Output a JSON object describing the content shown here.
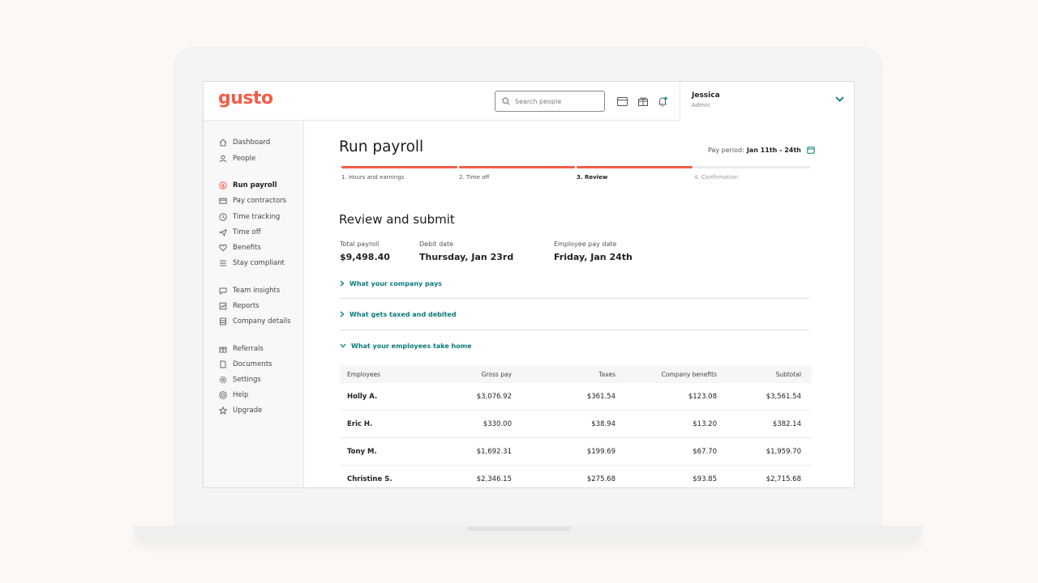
{
  "app": {
    "logo": "gusto",
    "brand_color": "#f45d48",
    "link_color": "#0a7a7a"
  },
  "header": {
    "search_placeholder": "Search people",
    "icons": [
      "card-icon",
      "gift-icon",
      "bell-icon"
    ],
    "user": {
      "name": "Jessica",
      "role": "Admin"
    }
  },
  "sidebar": {
    "items": [
      {
        "label": "Dashboard",
        "icon": "home-icon"
      },
      {
        "label": "People",
        "icon": "people-icon"
      },
      {
        "label": "Run payroll",
        "icon": "dollar-icon",
        "active": true
      },
      {
        "label": "Pay contractors",
        "icon": "contractor-icon"
      },
      {
        "label": "Time tracking",
        "icon": "clock-icon"
      },
      {
        "label": "Time off",
        "icon": "plane-icon"
      },
      {
        "label": "Benefits",
        "icon": "heart-icon"
      },
      {
        "label": "Stay compliant",
        "icon": "list-icon"
      },
      {
        "label": "Team insights",
        "icon": "chat-icon"
      },
      {
        "label": "Reports",
        "icon": "report-icon"
      },
      {
        "label": "Company details",
        "icon": "building-icon"
      },
      {
        "label": "Referrals",
        "icon": "gift-icon"
      },
      {
        "label": "Documents",
        "icon": "document-icon"
      },
      {
        "label": "Settings",
        "icon": "gear-icon"
      },
      {
        "label": "Help",
        "icon": "help-icon"
      },
      {
        "label": "Upgrade",
        "icon": "star-icon"
      }
    ]
  },
  "main": {
    "title": "Run payroll",
    "pay_period_label": "Pay period:",
    "pay_period_value": "Jan 11th - 24th",
    "steps": [
      {
        "label": "1. Hours and earnings",
        "state": "done"
      },
      {
        "label": "2. Time off",
        "state": "done"
      },
      {
        "label": "3. Review",
        "state": "current"
      },
      {
        "label": "4. Confirmation",
        "state": "future"
      }
    ],
    "section_title": "Review and submit",
    "summary": {
      "total_payroll_label": "Total payroll",
      "total_payroll_value": "$9,498.40",
      "debit_date_label": "Debit date",
      "debit_date_value": "Thursday, Jan 23rd",
      "employee_pay_date_label": "Employee pay date",
      "employee_pay_date_value": "Friday, Jan 24th"
    },
    "accordions": [
      {
        "label": "What your company pays",
        "expanded": false
      },
      {
        "label": "What gets taxed and debited",
        "expanded": false
      },
      {
        "label": "What your employees take home",
        "expanded": true
      }
    ],
    "table": {
      "headers": {
        "employees": "Employees",
        "gross_pay": "Gross pay",
        "taxes": "Taxes",
        "company_benefits": "Company benefits",
        "subtotal": "Subtotal"
      },
      "rows": [
        {
          "employee": "Holly A.",
          "gross_pay": "$3,076.92",
          "taxes": "$361.54",
          "company_benefits": "$123.08",
          "subtotal": "$3,561.54"
        },
        {
          "employee": "Eric H.",
          "gross_pay": "$330.00",
          "taxes": "$38.94",
          "company_benefits": "$13.20",
          "subtotal": "$382.14"
        },
        {
          "employee": "Tony M.",
          "gross_pay": "$1,692.31",
          "taxes": "$199.69",
          "company_benefits": "$67.70",
          "subtotal": "$1,959.70"
        },
        {
          "employee": "Christine S.",
          "gross_pay": "$2,346.15",
          "taxes": "$275.68",
          "company_benefits": "$93.85",
          "subtotal": "$2,715.68"
        }
      ]
    }
  }
}
